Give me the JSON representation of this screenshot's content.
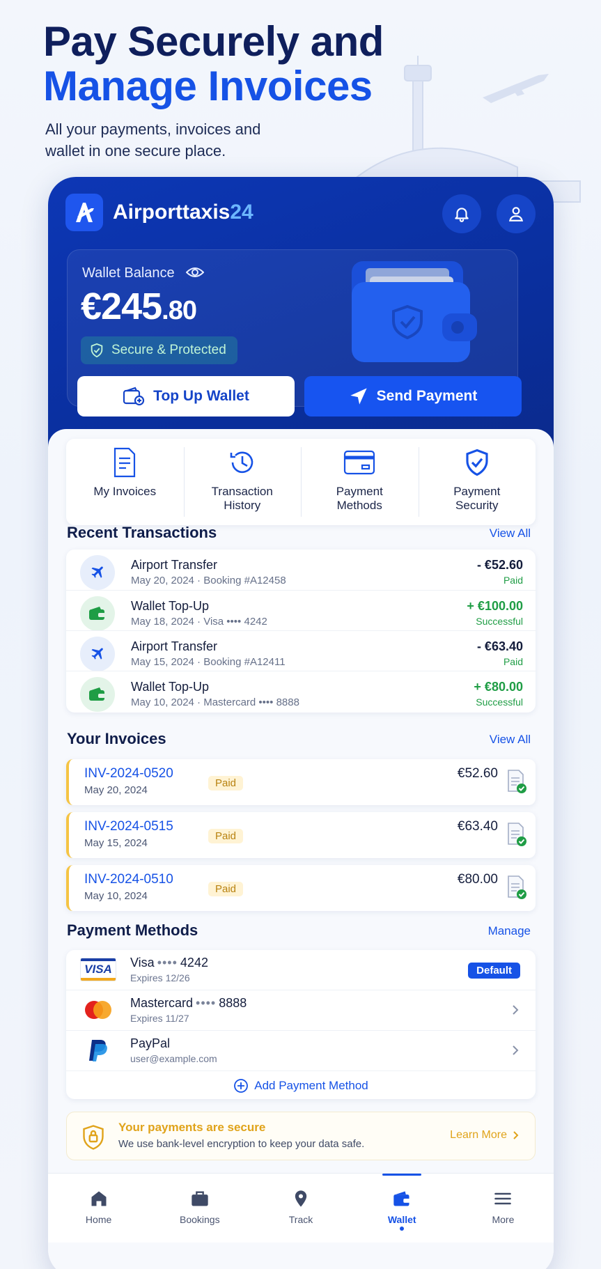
{
  "hero": {
    "title_line1": "Pay Securely and",
    "title_line2": "Manage Invoices",
    "subtitle": "All your payments, invoices and wallet in one secure place."
  },
  "app": {
    "brand_main": "Airporttaxis",
    "brand_num": "24",
    "icons": {
      "logo": "airplane-logo-icon",
      "bell": "bell-icon",
      "user": "user-icon"
    }
  },
  "wallet": {
    "label": "Wallet Balance",
    "amount_main": "€245",
    "amount_cents": ".80",
    "badge": "Secure & Protected",
    "topup_label": "Top Up Wallet",
    "send_label": "Send Payment"
  },
  "quick_actions": [
    {
      "label": "My Invoices",
      "icon": "document-icon"
    },
    {
      "label": "Transaction History",
      "icon": "history-icon"
    },
    {
      "label": "Payment Methods",
      "icon": "card-icon"
    },
    {
      "label": "Payment Security",
      "icon": "shield-check-icon"
    }
  ],
  "transactions": {
    "title": "Recent Transactions",
    "view_all": "View All",
    "items": [
      {
        "title": "Airport Transfer",
        "sub": "May 20, 2024 · Booking #A12458",
        "amount": "- €52.60",
        "status": "Paid",
        "type": "plane"
      },
      {
        "title": "Wallet Top-Up",
        "sub": "May 18, 2024 · Visa •••• 4242",
        "amount": "+ €100.00",
        "status": "Successful",
        "type": "wallet"
      },
      {
        "title": "Airport Transfer",
        "sub": "May 15, 2024 · Booking #A12411",
        "amount": "- €63.40",
        "status": "Paid",
        "type": "plane"
      },
      {
        "title": "Wallet Top-Up",
        "sub": "May 10, 2024 · Mastercard •••• 8888",
        "amount": "+ €80.00",
        "status": "Successful",
        "type": "wallet"
      }
    ]
  },
  "invoices": {
    "title": "Your Invoices",
    "view_all": "View All",
    "items": [
      {
        "id": "INV-2024-0520",
        "date": "May 20, 2024",
        "status": "Paid",
        "amount": "€52.60"
      },
      {
        "id": "INV-2024-0515",
        "date": "May 15, 2024",
        "status": "Paid",
        "amount": "€63.40"
      },
      {
        "id": "INV-2024-0510",
        "date": "May 10, 2024",
        "status": "Paid",
        "amount": "€80.00"
      }
    ]
  },
  "payment_methods": {
    "title": "Payment Methods",
    "manage": "Manage",
    "items": [
      {
        "name": "Visa",
        "dots": "••••",
        "last4": "4242",
        "sub": "Expires 12/26",
        "badge": "Default"
      },
      {
        "name": "Mastercard",
        "dots": "••••",
        "last4": "8888",
        "sub": "Expires 11/27"
      },
      {
        "name": "PayPal",
        "sub": "user@example.com"
      }
    ],
    "visa_logo_text": "VISA",
    "add_label": "Add Payment Method"
  },
  "security_note": {
    "title": "Your payments are secure",
    "desc": "We use bank-level encryption to keep your data safe.",
    "learn_more": "Learn More"
  },
  "bottom_nav": [
    {
      "label": "Home",
      "icon": "home-icon"
    },
    {
      "label": "Bookings",
      "icon": "briefcase-icon"
    },
    {
      "label": "Track",
      "icon": "location-pin-icon"
    },
    {
      "label": "Wallet",
      "icon": "wallet-icon",
      "active": true
    },
    {
      "label": "More",
      "icon": "menu-icon"
    }
  ],
  "colors": {
    "primary": "#1652e6",
    "dark_blue": "#0d37b5",
    "success": "#1f9d45",
    "negative": "#141d3c",
    "warning": "#e0a31a"
  }
}
